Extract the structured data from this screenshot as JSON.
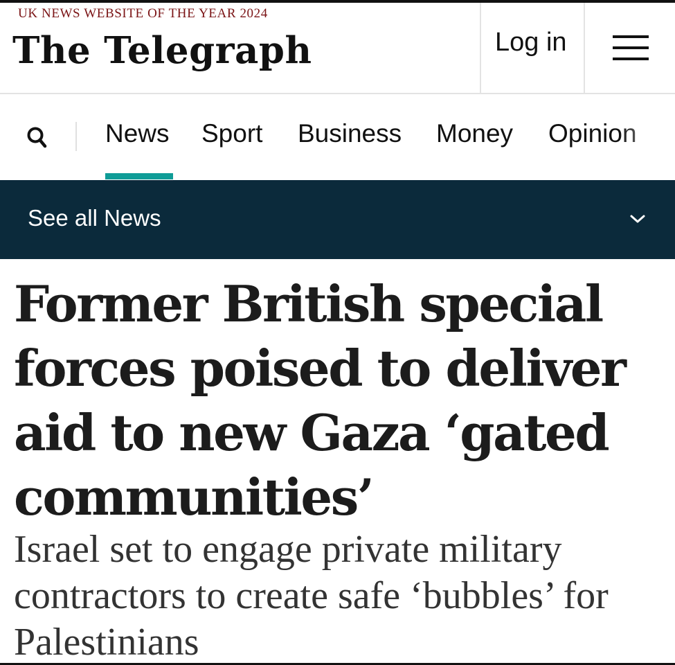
{
  "header": {
    "tagline": "UK NEWS WEBSITE OF THE YEAR 2024",
    "masthead": "The Telegraph",
    "login_label": "Log in",
    "menu_icon": "hamburger-menu-icon"
  },
  "nav": {
    "search_icon": "search-icon",
    "items": [
      {
        "label": "News",
        "active": true
      },
      {
        "label": "Sport",
        "active": false
      },
      {
        "label": "Business",
        "active": false
      },
      {
        "label": "Money",
        "active": false
      },
      {
        "label": "Opinion",
        "active": false
      }
    ],
    "accent_color": "#0f9c97"
  },
  "section_bar": {
    "label": "See all News",
    "background": "#0b2a3b",
    "icon": "chevron-down-icon"
  },
  "article": {
    "headline": "Former British special forces poised to deliver aid to new Gaza ‘gated communities’",
    "standfirst": "Israel set to engage private military contractors to create safe ‘bubbles’ for Palestinians"
  },
  "colors": {
    "tagline": "#7b1416",
    "text": "#111111"
  }
}
